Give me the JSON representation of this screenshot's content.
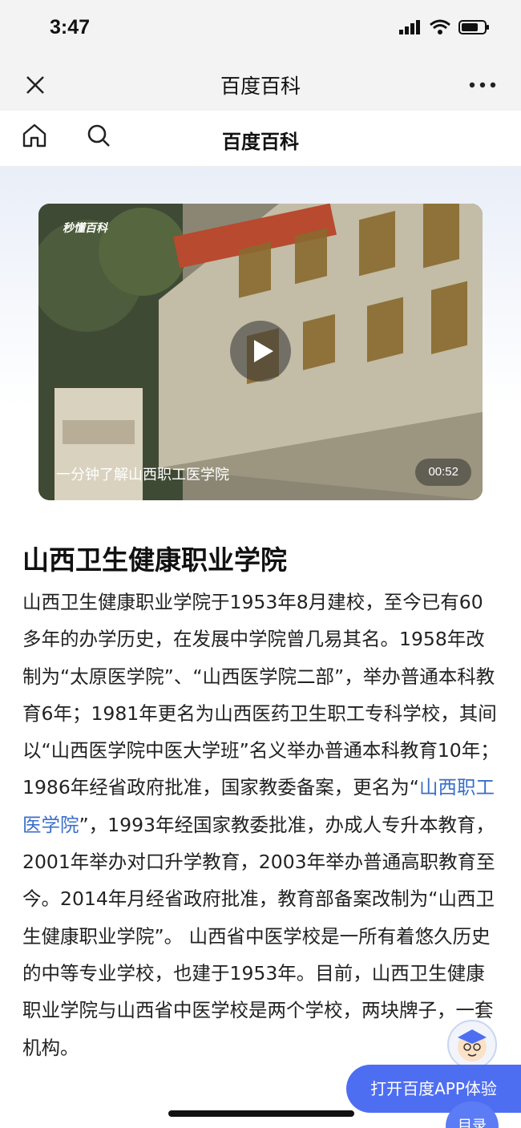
{
  "status_bar": {
    "time": "3:47"
  },
  "nav": {
    "title": "百度百科"
  },
  "site_header": {
    "title": "百度百科"
  },
  "video": {
    "watermark": "秒懂百科",
    "caption": "一分钟了解山西职工医学院",
    "duration": "00:52"
  },
  "article": {
    "title": "山西卫生健康职业学院",
    "body_before_link": "山西卫生健康职业学院于1953年8月建校，至今已有60多年的办学历史，在发展中学院曾几易其名。1958年改制为“太原医学院”、“山西医学院二部”，举办普通本科教育6年；1981年更名为山西医药卫生职工专科学校，其间以“山西医学院中医大学班”名义举办普通本科教育10年；1986年经省政府批准，国家教委备案，更名为“",
    "link_text": "山西职工医学院",
    "body_after_link": "”，1993年经国家教委批准，办成人专升本教育，2001年举办对口升学教育，2003年举办普通高职教育至今。2014年月经省政府批准，教育部备案改制为“山西卫生健康职业学院”。 山西省中医学校是一所有着悠久历史的中等专业学校，也建于1953年。目前，山西卫生健康职业学院与山西省中医学校是两个学校，两块牌子，一套机构。"
  },
  "floating": {
    "open_app_label": "打开百度APP体验",
    "toc_label": "目录"
  },
  "colors": {
    "accent": "#4e6ef2",
    "link": "#3a6ec9"
  }
}
